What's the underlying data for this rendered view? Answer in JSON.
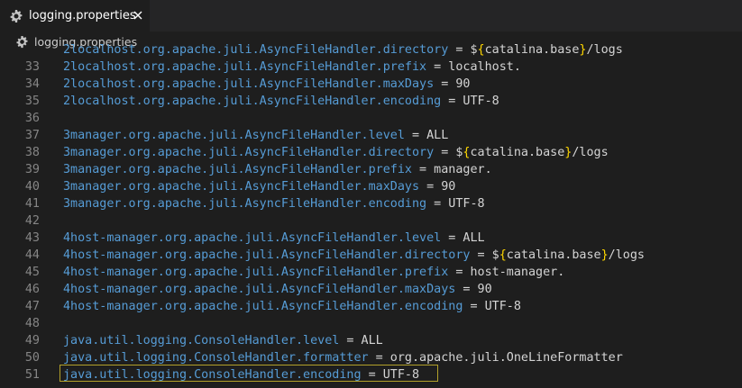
{
  "tab": {
    "label": "logging.properties"
  },
  "breadcrumb": {
    "label": "logging.properties"
  },
  "colors": {
    "key": "#569cd6",
    "text": "#d4d4d4",
    "brace": "#ffd700",
    "line_number": "#858585",
    "highlight_border": "#b3a12a"
  },
  "editor": {
    "lines": [
      {
        "num": "",
        "key": "2localhost.org.apache.juli.AsyncFileHandler.directory",
        "op": " = ",
        "pre": "$",
        "brace_open": "{",
        "mid": "catalina.base",
        "brace_close": "}",
        "post": "/logs"
      },
      {
        "num": "33",
        "key": "2localhost.org.apache.juli.AsyncFileHandler.prefix",
        "op": " = ",
        "val": "localhost."
      },
      {
        "num": "34",
        "key": "2localhost.org.apache.juli.AsyncFileHandler.maxDays",
        "op": " = ",
        "val": "90"
      },
      {
        "num": "35",
        "key": "2localhost.org.apache.juli.AsyncFileHandler.encoding",
        "op": " = ",
        "val": "UTF-8"
      },
      {
        "num": "36",
        "key": "",
        "op": "",
        "val": ""
      },
      {
        "num": "37",
        "key": "3manager.org.apache.juli.AsyncFileHandler.level",
        "op": " = ",
        "val": "ALL"
      },
      {
        "num": "38",
        "key": "3manager.org.apache.juli.AsyncFileHandler.directory",
        "op": " = ",
        "pre": "$",
        "brace_open": "{",
        "mid": "catalina.base",
        "brace_close": "}",
        "post": "/logs"
      },
      {
        "num": "39",
        "key": "3manager.org.apache.juli.AsyncFileHandler.prefix",
        "op": " = ",
        "val": "manager."
      },
      {
        "num": "40",
        "key": "3manager.org.apache.juli.AsyncFileHandler.maxDays",
        "op": " = ",
        "val": "90"
      },
      {
        "num": "41",
        "key": "3manager.org.apache.juli.AsyncFileHandler.encoding",
        "op": " = ",
        "val": "UTF-8"
      },
      {
        "num": "42",
        "key": "",
        "op": "",
        "val": ""
      },
      {
        "num": "43",
        "key": "4host-manager.org.apache.juli.AsyncFileHandler.level",
        "op": " = ",
        "val": "ALL"
      },
      {
        "num": "44",
        "key": "4host-manager.org.apache.juli.AsyncFileHandler.directory",
        "op": " = ",
        "pre": "$",
        "brace_open": "{",
        "mid": "catalina.base",
        "brace_close": "}",
        "post": "/logs"
      },
      {
        "num": "45",
        "key": "4host-manager.org.apache.juli.AsyncFileHandler.prefix",
        "op": " = ",
        "val": "host-manager."
      },
      {
        "num": "46",
        "key": "4host-manager.org.apache.juli.AsyncFileHandler.maxDays",
        "op": " = ",
        "val": "90"
      },
      {
        "num": "47",
        "key": "4host-manager.org.apache.juli.AsyncFileHandler.encoding",
        "op": " = ",
        "val": "UTF-8"
      },
      {
        "num": "48",
        "key": "",
        "op": "",
        "val": ""
      },
      {
        "num": "49",
        "key": "java.util.logging.ConsoleHandler.level",
        "op": " = ",
        "val": "ALL"
      },
      {
        "num": "50",
        "key": "java.util.logging.ConsoleHandler.formatter",
        "op": " = ",
        "val": "org.apache.juli.OneLineFormatter"
      },
      {
        "num": "51",
        "key": "java.util.logging.ConsoleHandler.encoding",
        "op": " = ",
        "val": "UTF-8"
      }
    ]
  }
}
